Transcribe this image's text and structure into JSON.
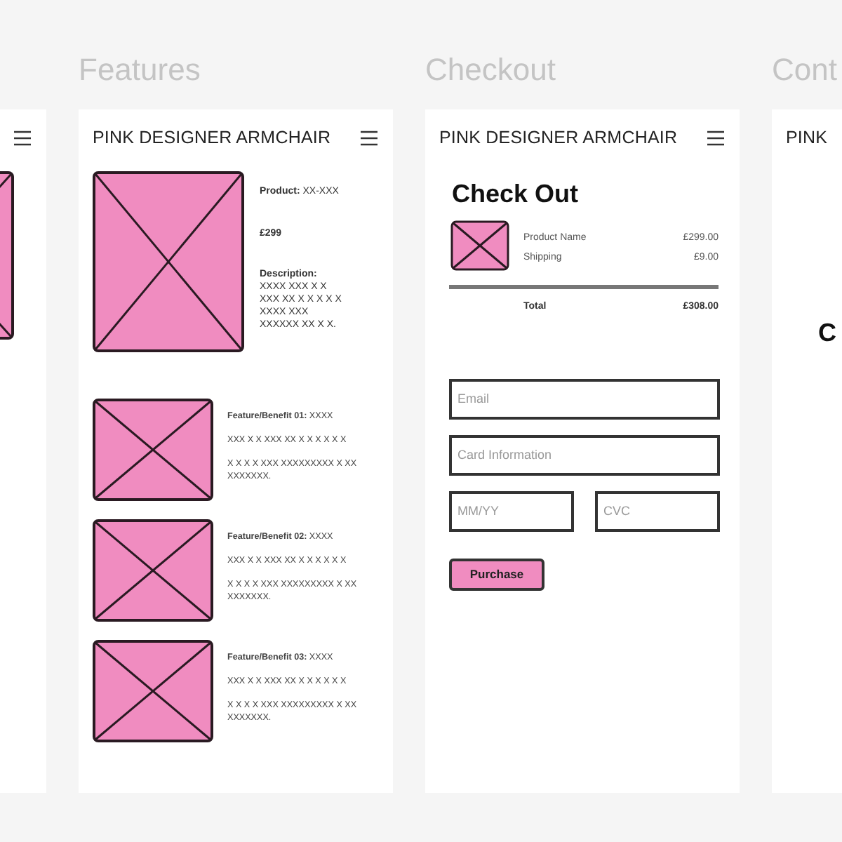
{
  "features": {
    "label": "Features",
    "header": "PINK DESIGNER ARMCHAIR",
    "product": "**Product:** XX-XXX",
    "price": "£299",
    "description_title": "Description:",
    "description": [
      "XXXX XXX X X",
      "XXX XX X X X X X",
      "XXXX XXX",
      "XXXXXX XX X X."
    ],
    "items": [
      {
        "title": "**Feature/Benefit 01:** XXXX",
        "lines": [
          "XXX X X XXX XX X X X X X X",
          "X X X X XXX XXXXXXXXX X XX XXXXXXX."
        ]
      },
      {
        "title": "**Feature/Benefit 02:** XXXX",
        "lines": [
          "XXX X X XXX XX X X X X X X",
          "X X X X XXX XXXXXXXXX X XX XXXXXXX."
        ]
      },
      {
        "title": "**Feature/Benefit 03:** XXXX",
        "lines": [
          "XXX X X XXX XX X X X X X X",
          "X X X X XXX XXXXXXXXX X XX XXXXXXX."
        ]
      }
    ]
  },
  "checkout": {
    "label": "Checkout",
    "header": "PINK DESIGNER ARMCHAIR",
    "heading": "Check Out",
    "lines": [
      {
        "name": "Product Name",
        "amount": "£299.00"
      },
      {
        "name": "Shipping",
        "amount": "£9.00"
      }
    ],
    "total": {
      "name": "Total",
      "amount": "£308.00"
    },
    "fields": [
      {
        "placeholder": "Email"
      },
      {
        "placeholder": "Card Information"
      },
      {
        "placeholder": "MM/YY"
      },
      {
        "placeholder": "CVC"
      }
    ],
    "button": "Purchase"
  },
  "contact": {
    "label": "Cont",
    "header": "PINK",
    "heading": "C"
  }
}
